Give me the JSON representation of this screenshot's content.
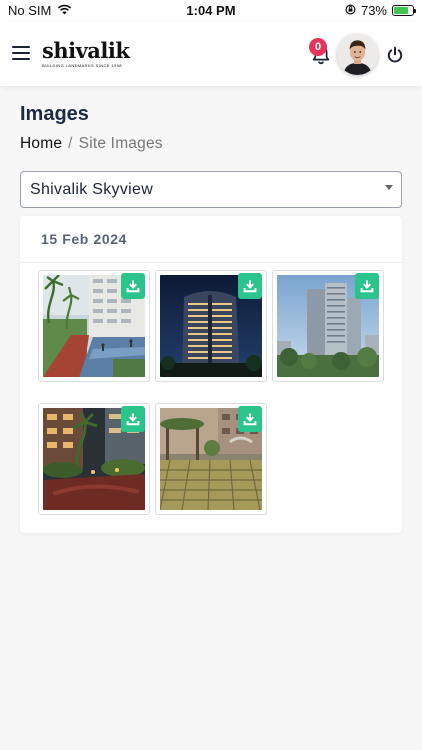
{
  "status_bar": {
    "carrier": "No SIM",
    "time": "1:04 PM",
    "battery": "73%"
  },
  "header": {
    "logo_text": "shivalik",
    "logo_tagline": "BUILDING LANDMARKS SINCE 1998",
    "notification_count": "0"
  },
  "page": {
    "title": "Images",
    "breadcrumb": {
      "home": "Home",
      "separator": "/",
      "current": "Site Images"
    }
  },
  "site_select": {
    "selected": "Shivalik Skyview"
  },
  "gallery": {
    "date": "15 Feb 2024",
    "images": [
      {
        "scene": "pool-courtyard"
      },
      {
        "scene": "tower-night"
      },
      {
        "scene": "tower-day"
      },
      {
        "scene": "garden-evening"
      },
      {
        "scene": "pergola-plaza"
      }
    ]
  },
  "colors": {
    "accent_download": "#2bc58b",
    "badge": "#e6345d",
    "title": "#1d2a44"
  },
  "icons": [
    "menu-icon",
    "bell-icon",
    "power-icon",
    "download-icon",
    "chevron-down-icon",
    "wifi-icon",
    "battery-icon"
  ]
}
